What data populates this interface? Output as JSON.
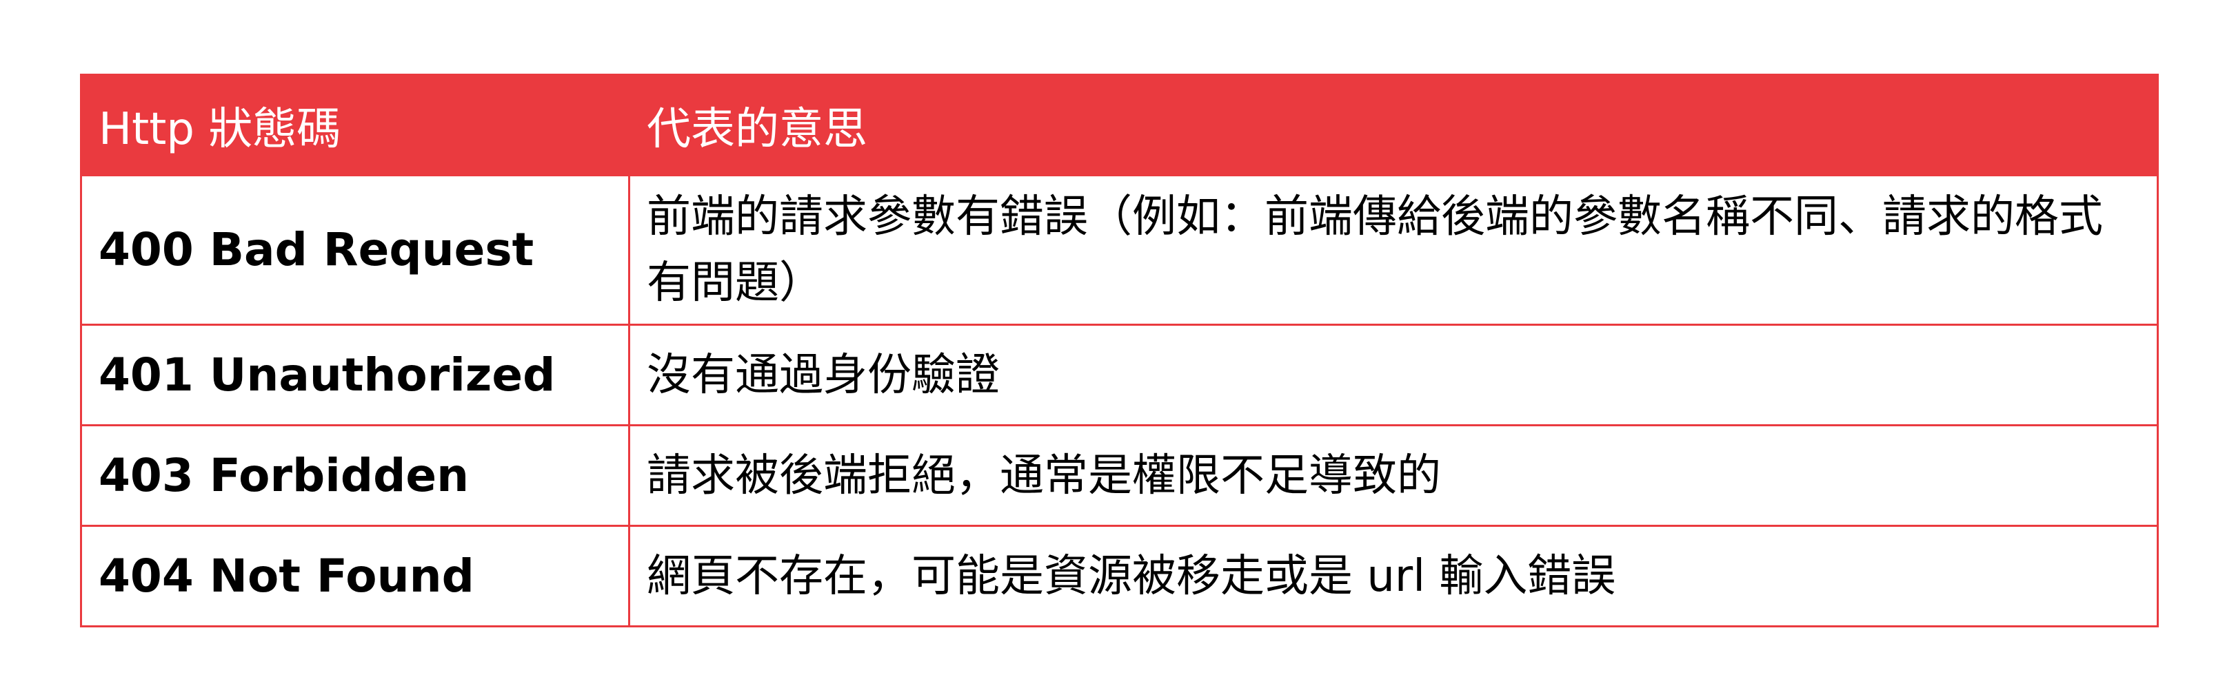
{
  "table": {
    "headers": {
      "status_code": "Http 狀態碼",
      "meaning": "代表的意思"
    },
    "rows": [
      {
        "code": "400 Bad Request",
        "meaning": "前端的請求參數有錯誤（例如：前端傳給後端的參數名稱不同、請求的格式有問題）"
      },
      {
        "code": "401 Unauthorized",
        "meaning": "沒有通過身份驗證"
      },
      {
        "code": "403 Forbidden",
        "meaning": "請求被後端拒絕，通常是權限不足導致的"
      },
      {
        "code": "404 Not Found",
        "meaning": "網頁不存在，可能是資源被移走或是 url 輸入錯誤"
      }
    ]
  },
  "colors": {
    "accent": "#ea3a3f",
    "header_text": "#ffffff",
    "body_text": "#000000"
  }
}
